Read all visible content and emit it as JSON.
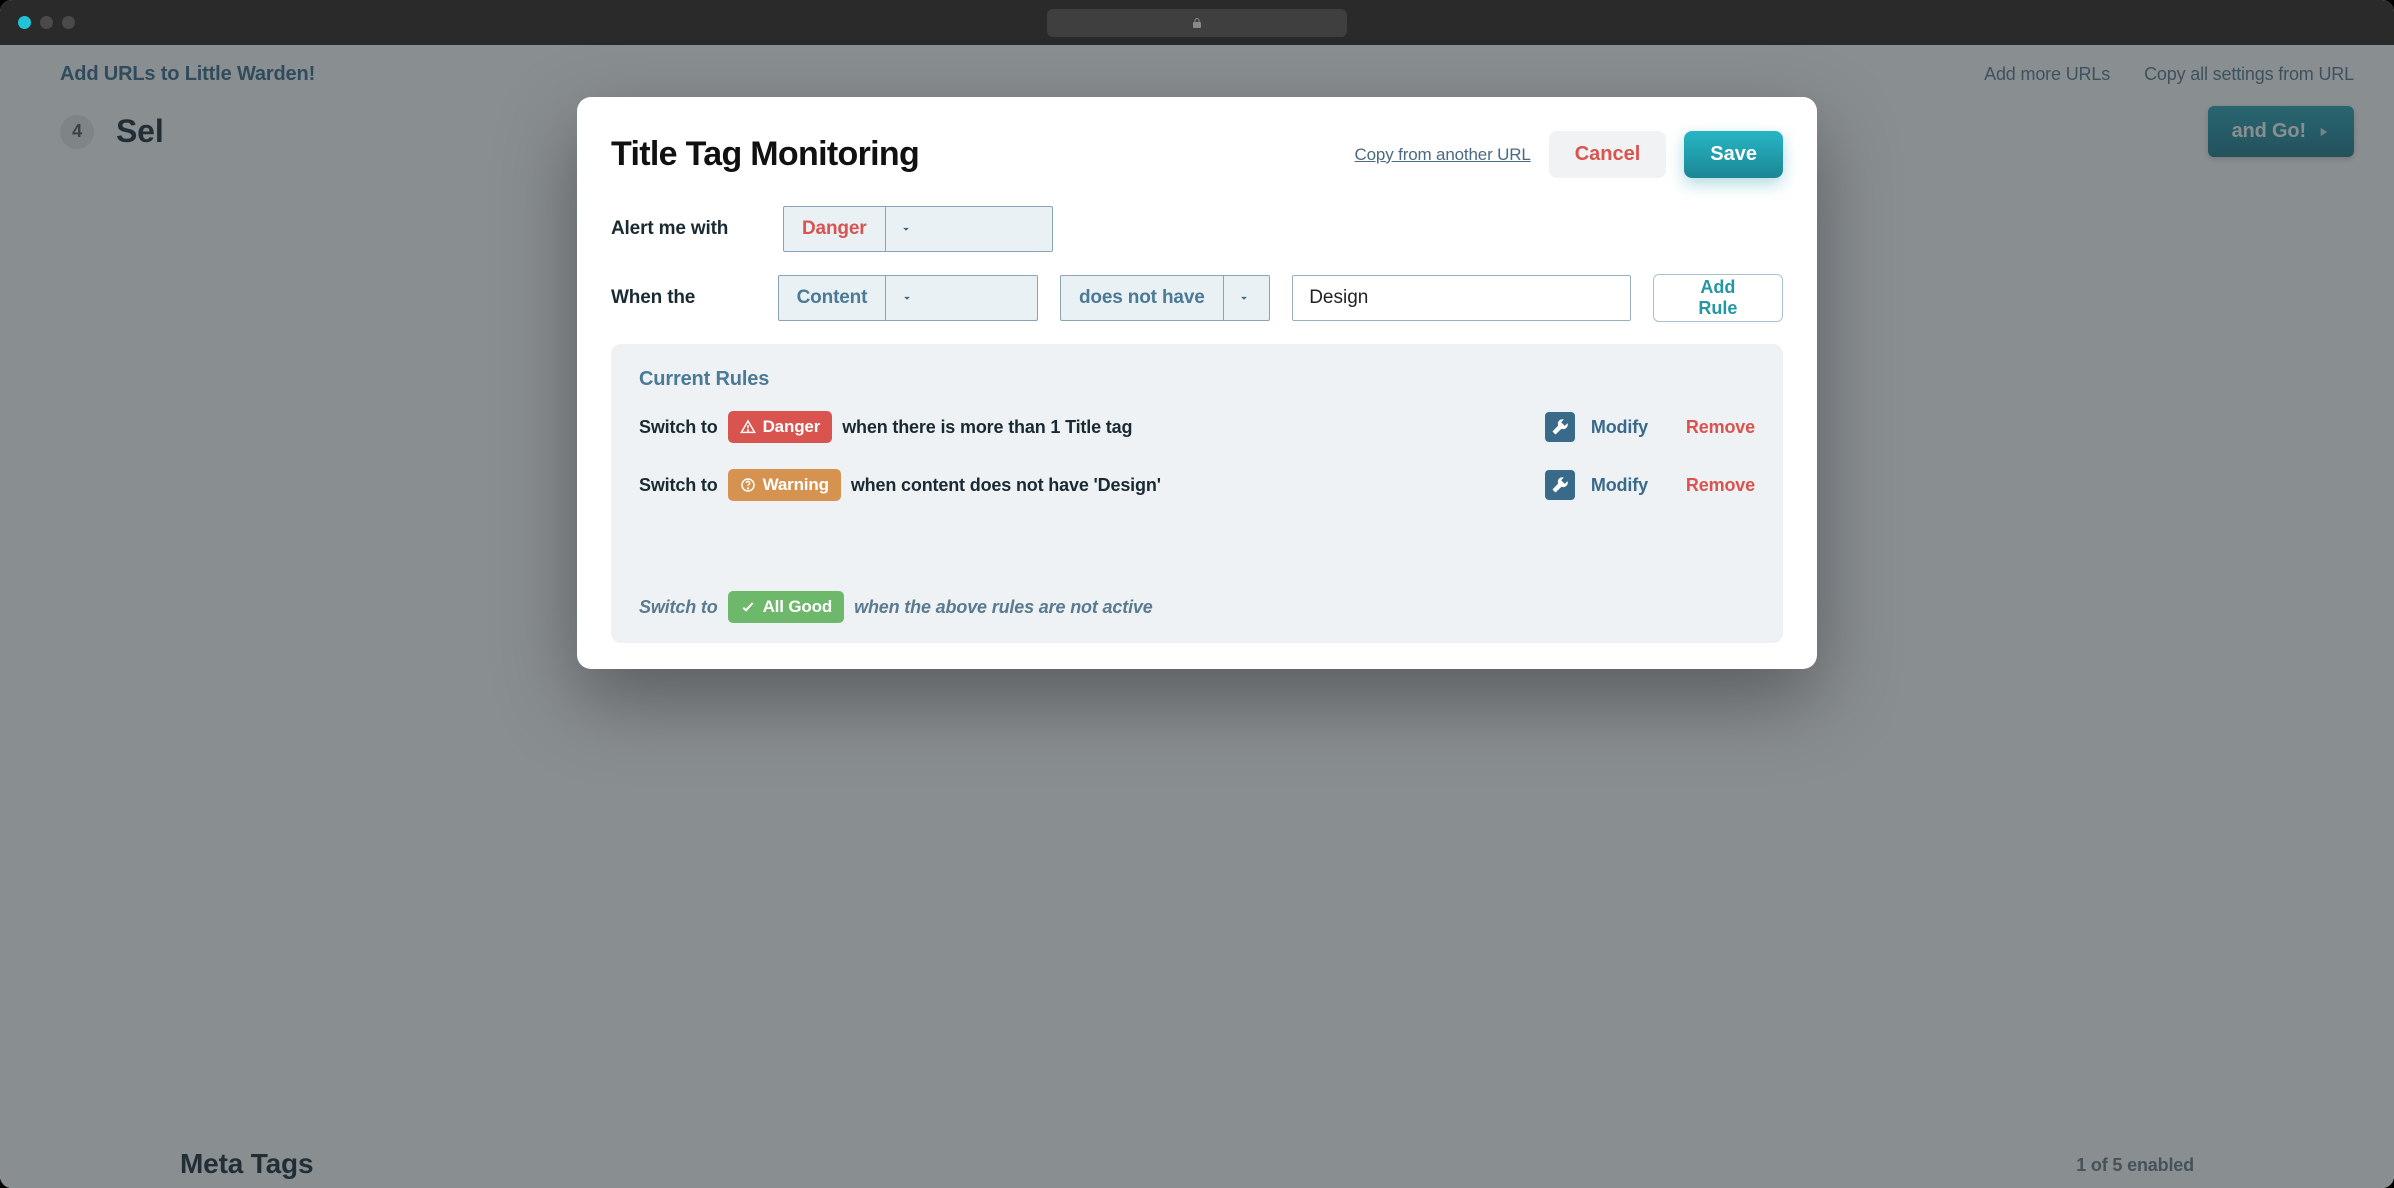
{
  "page": {
    "header_left": "Add URLs to Little Warden!",
    "header_links": {
      "add_more": "Add more URLs",
      "copy_settings": "Copy all settings from URL"
    },
    "step": {
      "num": "4",
      "title": "Sel"
    },
    "go_button": "and Go!",
    "meta_section": {
      "title": "Meta Tags",
      "count": "1 of 5 enabled"
    }
  },
  "modal": {
    "title": "Title Tag Monitoring",
    "copy_link": "Copy from another URL",
    "cancel": "Cancel",
    "save": "Save",
    "labels": {
      "alert": "Alert me with",
      "when": "When the"
    },
    "selects": {
      "alert_level": "Danger",
      "subject": "Content",
      "condition": "does not have"
    },
    "value_input": "Design",
    "add_rule": "Add Rule",
    "current_rules_title": "Current Rules",
    "switch_to": "Switch to",
    "rules": [
      {
        "badge": "Danger",
        "badge_type": "danger",
        "text": "when there is more than 1 Title tag"
      },
      {
        "badge": "Warning",
        "badge_type": "warning",
        "text": "when content does not have 'Design'"
      }
    ],
    "modify": "Modify",
    "remove": "Remove",
    "fallback": {
      "badge": "All Good",
      "text": "when the above rules are not active"
    }
  }
}
